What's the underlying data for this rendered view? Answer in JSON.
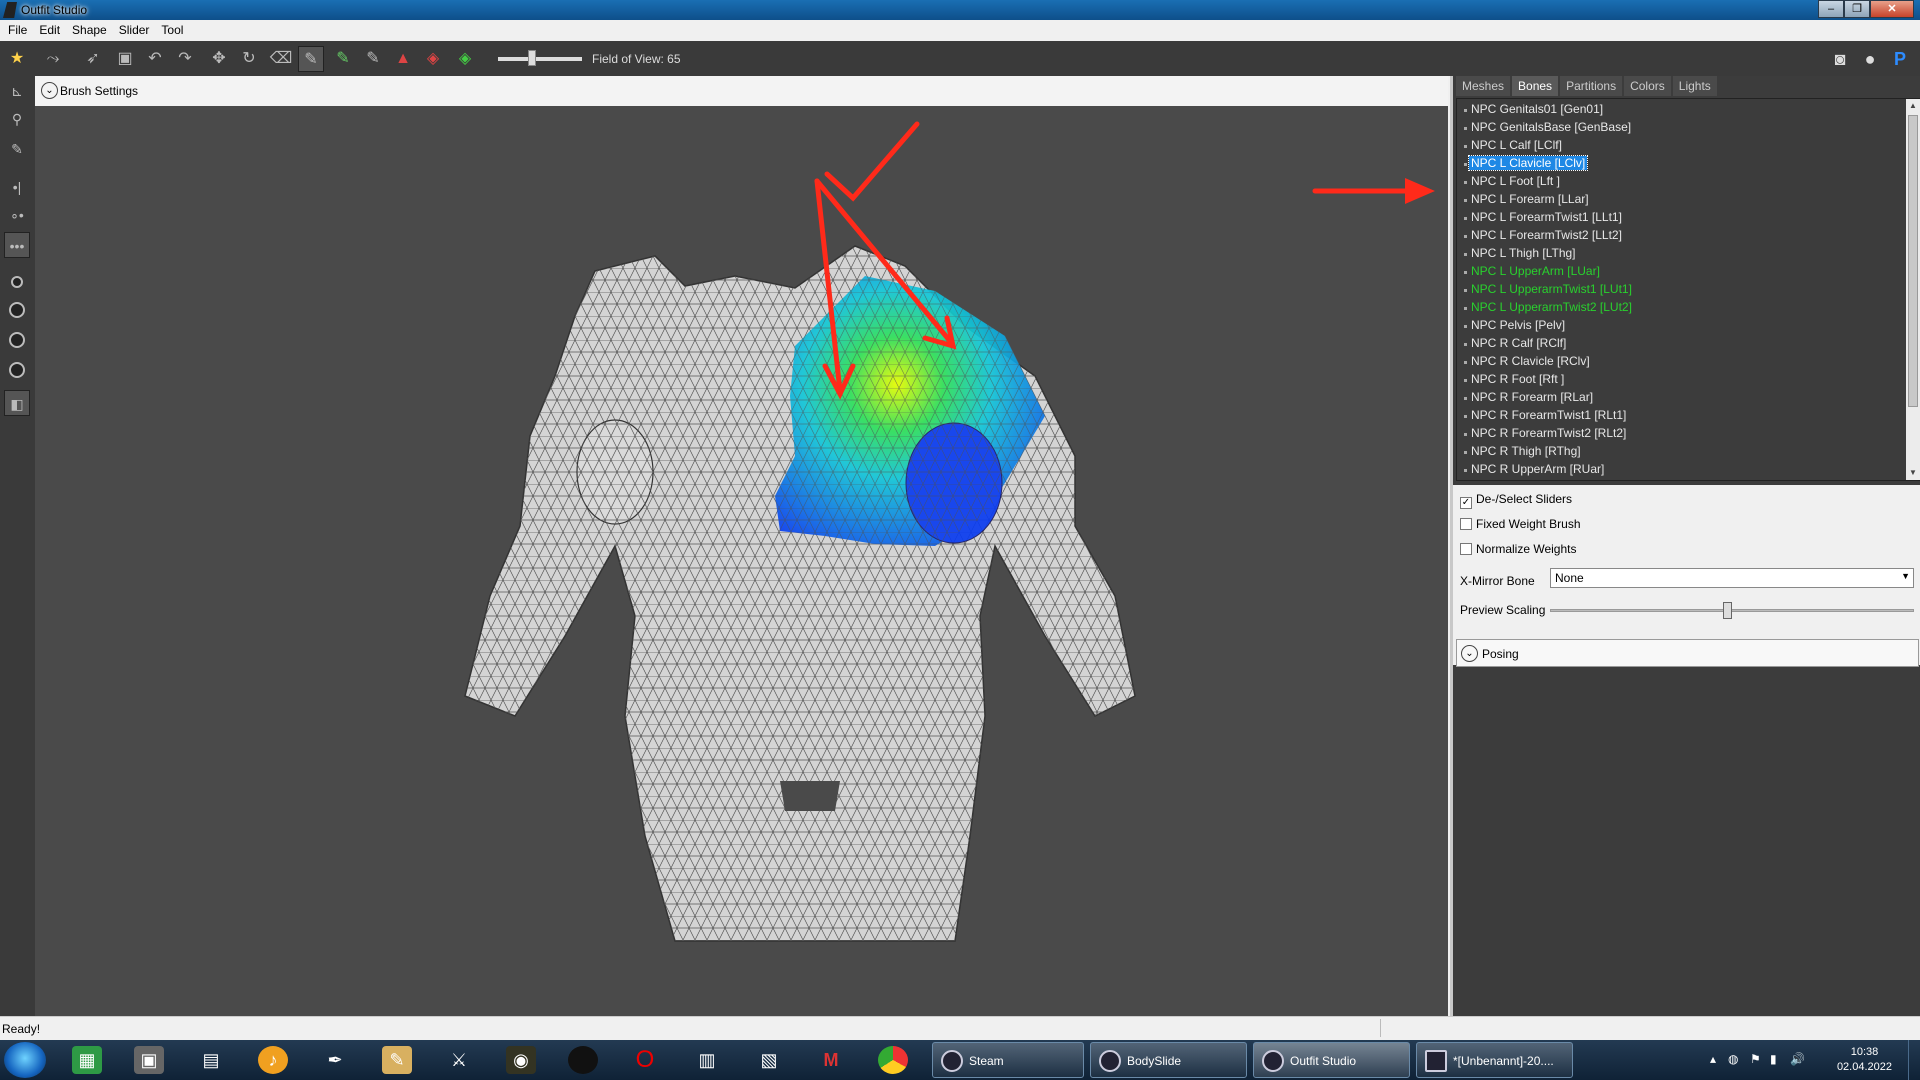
{
  "window": {
    "title": "Outfit Studio"
  },
  "menu": [
    "File",
    "Edit",
    "Shape",
    "Slider",
    "Tool"
  ],
  "toolbar": {
    "fov_label": "Field of View: 65",
    "fov_value": 65
  },
  "viewport": {
    "header_label": "Brush Settings"
  },
  "panel": {
    "tabs": [
      "Meshes",
      "Bones",
      "Partitions",
      "Colors",
      "Lights"
    ],
    "active_tab": "Bones",
    "bones": [
      {
        "name": "NPC Genitals01 [Gen01]",
        "state": "normal"
      },
      {
        "name": "NPC GenitalsBase [GenBase]",
        "state": "normal"
      },
      {
        "name": "NPC L Calf [LClf]",
        "state": "normal"
      },
      {
        "name": "NPC L Clavicle [LClv]",
        "state": "selected"
      },
      {
        "name": "NPC L Foot [Lft ]",
        "state": "normal"
      },
      {
        "name": "NPC L Forearm [LLar]",
        "state": "normal"
      },
      {
        "name": "NPC L ForearmTwist1 [LLt1]",
        "state": "normal"
      },
      {
        "name": "NPC L ForearmTwist2 [LLt2]",
        "state": "normal"
      },
      {
        "name": "NPC L Thigh [LThg]",
        "state": "normal"
      },
      {
        "name": "NPC L UpperArm [LUar]",
        "state": "green"
      },
      {
        "name": "NPC L UpperarmTwist1 [LUt1]",
        "state": "green"
      },
      {
        "name": "NPC L UpperarmTwist2 [LUt2]",
        "state": "green"
      },
      {
        "name": "NPC Pelvis [Pelv]",
        "state": "normal"
      },
      {
        "name": "NPC R Calf [RClf]",
        "state": "normal"
      },
      {
        "name": "NPC R Clavicle [RClv]",
        "state": "normal"
      },
      {
        "name": "NPC R Foot [Rft ]",
        "state": "normal"
      },
      {
        "name": "NPC R Forearm [RLar]",
        "state": "normal"
      },
      {
        "name": "NPC R ForearmTwist1 [RLt1]",
        "state": "normal"
      },
      {
        "name": "NPC R ForearmTwist2 [RLt2]",
        "state": "normal"
      },
      {
        "name": "NPC R Thigh [RThg]",
        "state": "normal"
      },
      {
        "name": "NPC R UpperArm [RUar]",
        "state": "normal"
      }
    ],
    "checkboxes": [
      {
        "label": "De-/Select Sliders",
        "checked": true
      },
      {
        "label": "Fixed Weight Brush",
        "checked": false
      },
      {
        "label": "Normalize Weights",
        "checked": false
      }
    ],
    "xmirror": {
      "label": "X-Mirror Bone",
      "value": "None"
    },
    "preview_scaling": {
      "label": "Preview Scaling",
      "value_fraction": 0.5
    },
    "posing": {
      "label": "Posing"
    }
  },
  "status": {
    "text": "Ready!"
  },
  "taskbar": {
    "tasks": [
      "Steam",
      "BodySlide",
      "Outfit Studio",
      "*[Unbenannt]-20...."
    ],
    "active_task": "Outfit Studio",
    "time": "10:38",
    "date": "02.04.2022"
  },
  "colors": {
    "selected_bone": "#1e88e5",
    "green_bone": "#29d12e",
    "viewport_bg": "#4a4a4a",
    "annotation_arrow": "#ff2a1a"
  }
}
